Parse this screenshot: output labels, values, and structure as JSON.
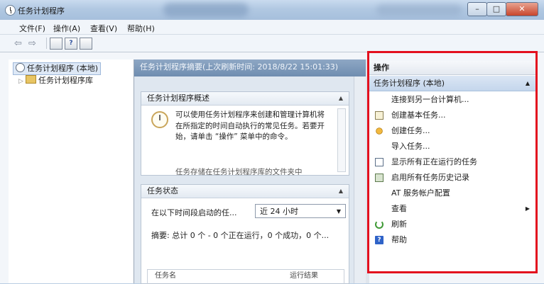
{
  "window": {
    "title": "任务计划程序",
    "min": "–",
    "max": "□",
    "close": "✕"
  },
  "menu": [
    "文件(F)",
    "操作(A)",
    "查看(V)",
    "帮助(H)"
  ],
  "toolbar": {
    "back": "⇦",
    "forward": "⇨",
    "help_glyph": "?"
  },
  "tree": {
    "root": "任务计划程序 (本地)",
    "child": "任务计划程序库",
    "expander": "▷"
  },
  "center": {
    "summary_header": "任务计划程序摘要(上次刷新时间: 2018/8/22 15:01:33)",
    "overview": {
      "title": "任务计划程序概述",
      "text": "可以使用任务计划程序来创建和管理计算机将在所指定的时间自动执行的常见任务。若要开始，请单击 “操作” 菜单中的命令。",
      "cut_line": "任务存储在任务计划程序库的文件夹中"
    },
    "status": {
      "title": "任务状态",
      "filter_label": "在以下时间段启动的任...",
      "filter_value": "近 24 小时",
      "summary": "摘要: 总计 0 个 - 0 个正在运行，0 个成功，0 个...",
      "col_name": "任务名",
      "col_result": "运行结果"
    }
  },
  "actions": {
    "header": "操作",
    "group": "任务计划程序 (本地)",
    "items": [
      {
        "label": "连接到另一台计算机...",
        "icon": "none"
      },
      {
        "label": "创建基本任务...",
        "icon": "create-basic-task-icon"
      },
      {
        "label": "创建任务...",
        "icon": "create-task-icon"
      },
      {
        "label": "导入任务...",
        "icon": "none"
      },
      {
        "label": "显示所有正在运行的任务",
        "icon": "running-tasks-icon"
      },
      {
        "label": "启用所有任务历史记录",
        "icon": "task-history-icon"
      },
      {
        "label": "AT 服务帐户配置",
        "icon": "none"
      },
      {
        "label": "查看",
        "icon": "none"
      },
      {
        "label": "刷新",
        "icon": "refresh-icon"
      },
      {
        "label": "帮助",
        "icon": "help-icon"
      }
    ]
  },
  "colors": {
    "highlight_border": "#e3101e",
    "header_blue": "#7f9aba"
  }
}
